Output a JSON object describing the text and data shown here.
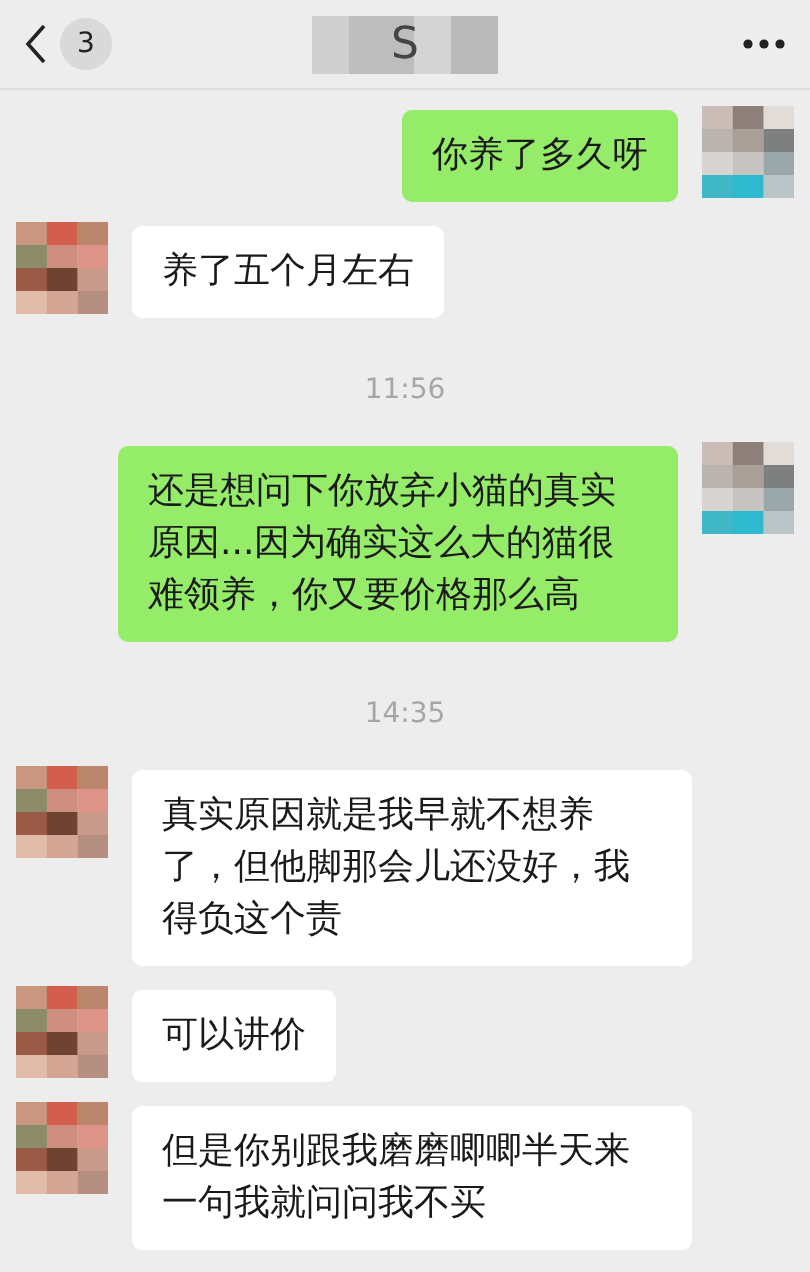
{
  "header": {
    "back_badge": "3",
    "title": "S"
  },
  "messages": [
    {
      "kind": "sent",
      "text": "你养了多久呀"
    },
    {
      "kind": "received",
      "text": "养了五个月左右"
    },
    {
      "kind": "time",
      "text": "11:56"
    },
    {
      "kind": "sent",
      "text": "还是想问下你放弃小猫的真实原因...因为确实这么大的猫很难领养，你又要价格那么高"
    },
    {
      "kind": "time",
      "text": "14:35"
    },
    {
      "kind": "received",
      "text": "真实原因就是我早就不想养了，但他脚那会儿还没好，我得负这个责"
    },
    {
      "kind": "received",
      "text": "可以讲价"
    },
    {
      "kind": "received",
      "text": "但是你别跟我磨磨唧唧半天来一句我就问问我不买"
    }
  ]
}
